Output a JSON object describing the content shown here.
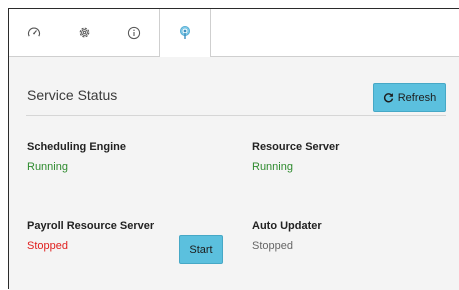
{
  "tabs": [
    {
      "icon": "gauge-icon"
    },
    {
      "icon": "gear-icon"
    },
    {
      "icon": "info-icon"
    },
    {
      "icon": "broadcast-icon",
      "active": true
    }
  ],
  "panel": {
    "title": "Service Status",
    "refresh_label": "Refresh"
  },
  "services": [
    {
      "name": "Scheduling Engine",
      "status": "Running",
      "status_color": "#2e8b2e"
    },
    {
      "name": "Resource Server",
      "status": "Running",
      "status_color": "#2e8b2e"
    },
    {
      "name": "Payroll Resource Server",
      "status": "Stopped",
      "status_color": "#e0201f",
      "action_label": "Start"
    },
    {
      "name": "Auto Updater",
      "status": "Stopped",
      "status_color": "#666666"
    }
  ],
  "colors": {
    "accent": "#5bc0de",
    "running": "#2e8b2e",
    "stopped_error": "#e0201f",
    "stopped_neutral": "#666666"
  }
}
